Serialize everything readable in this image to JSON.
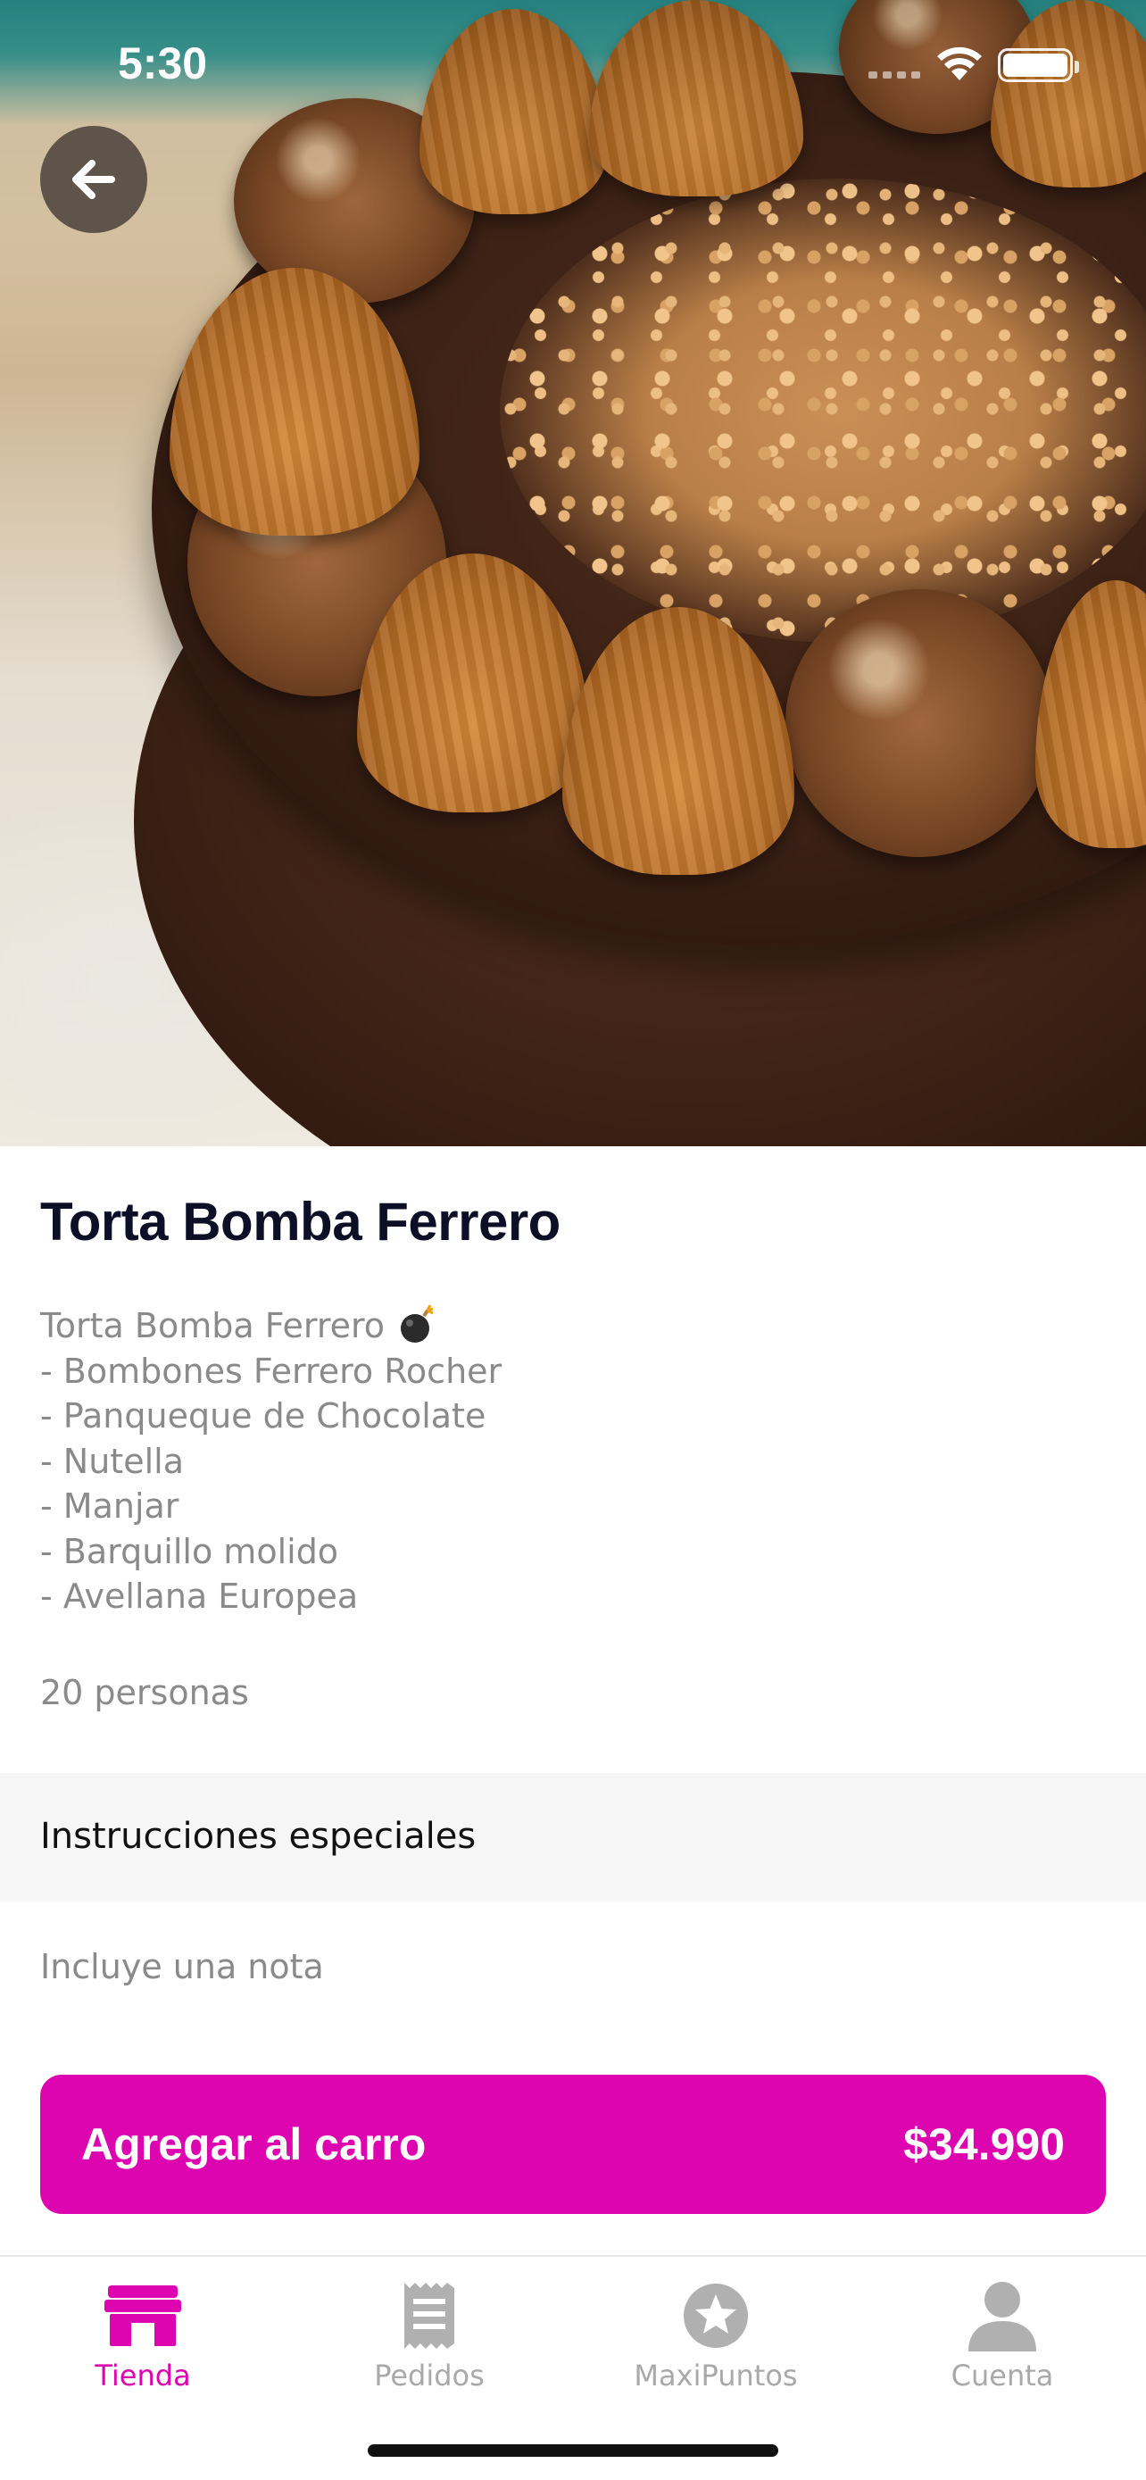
{
  "status_bar": {
    "time": "5:30"
  },
  "product": {
    "name": "Torta Bomba Ferrero",
    "description_lines": [
      "Torta Bomba Ferrero",
      "- Bombones Ferrero Rocher",
      "- Panqueque de Chocolate",
      "- Nutella",
      "- Manjar",
      "- Barquillo molido",
      "- Avellana Europea"
    ],
    "servings": "20 personas",
    "image_icon": "cake-photo"
  },
  "special_instructions": {
    "title": "Instrucciones especiales",
    "note_placeholder": "Incluye una nota"
  },
  "cart_button": {
    "label": "Agregar al carro",
    "price": "$34.990"
  },
  "tabbar": {
    "items": [
      {
        "label": "Tienda",
        "icon": "store-icon",
        "active": true
      },
      {
        "label": "Pedidos",
        "icon": "receipt-icon",
        "active": false
      },
      {
        "label": "MaxiPuntos",
        "icon": "star-icon",
        "active": false
      },
      {
        "label": "Cuenta",
        "icon": "user-icon",
        "active": false
      }
    ]
  },
  "colors": {
    "accent": "#dd05b0",
    "title": "#0d0f26",
    "muted": "#8a8a8a",
    "inactive": "#a9a9a9"
  }
}
